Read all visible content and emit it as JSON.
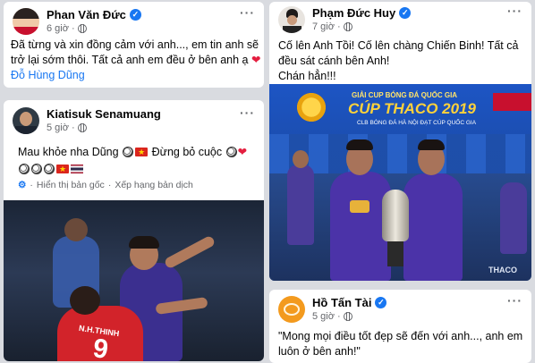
{
  "posts": [
    {
      "name": "Phan Văn Đức",
      "time": "6 giờ",
      "more": "···",
      "line1": "Đã từng và xin đồng cảm với anh..., em tin anh sẽ",
      "line2": "trở lại sớm thôi. Tất cả anh em đều ở bên anh ạ",
      "tag": "Đỗ Hùng Dũng"
    },
    {
      "name": "Kiatisuk Senamuang",
      "time": "5 giờ",
      "more": "···",
      "line1_a": "Mau khỏe nha Dũng",
      "line1_b": "Đừng bỏ cuộc",
      "translate_label": "Hiển thị bản gốc",
      "rate_label": "Xếp hạng bản dịch",
      "dot": "·",
      "photo_jersey_name": "N.H.THINH",
      "photo_jersey_number": "9"
    },
    {
      "name": "Phạm Đức Huy",
      "time": "7 giờ",
      "more": "···",
      "line1": "Cố lên Anh Tồi! Cố lên chàng Chiến Binh! Tất cả",
      "line2": "đều sát cánh bên Anh!",
      "line3": "Chán hẳn!!!",
      "banner_small": "GIẢI CUP BÓNG ĐÁ QUỐC GIA",
      "banner_big": "CÚP THACO 2019",
      "banner_sub": "CLB BÓNG ĐÁ HÀ NỘI ĐẠT CÚP QUỐC GIA",
      "sponsor": "THACO"
    },
    {
      "name": "Hồ Tấn Tài",
      "time": "5 giờ",
      "more": "···",
      "line1": "\"Mong mọi điều tốt đẹp sẽ đến với anh..., anh em",
      "line2": "luôn ở bên anh!\""
    }
  ]
}
